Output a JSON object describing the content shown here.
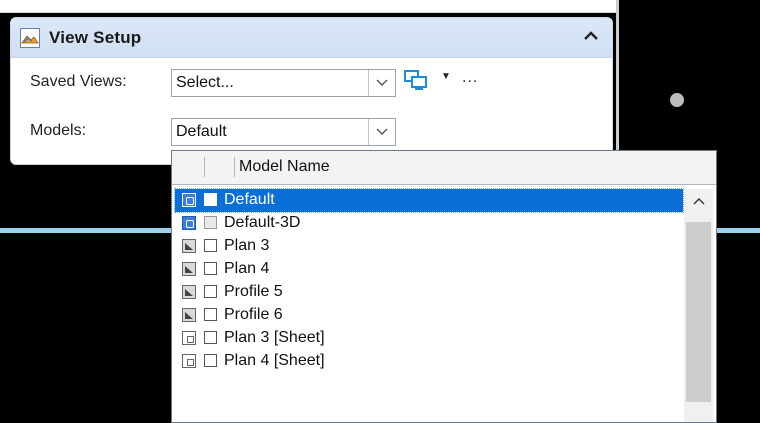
{
  "panel": {
    "title": "View Setup"
  },
  "saved_views": {
    "label": "Saved Views:",
    "value": "Select..."
  },
  "models": {
    "label": "Models:",
    "value": "Default"
  },
  "toolbar": {
    "more_label": "..."
  },
  "dropdown": {
    "column_header": "Model Name",
    "items": [
      {
        "name": "Default",
        "icon": "2d-model-icon",
        "selected": true
      },
      {
        "name": "Default-3D",
        "icon": "3d-model-icon",
        "selected": false
      },
      {
        "name": "Plan 3",
        "icon": "drawing-icon",
        "selected": false
      },
      {
        "name": "Plan 4",
        "icon": "drawing-icon",
        "selected": false
      },
      {
        "name": "Profile 5",
        "icon": "drawing-icon",
        "selected": false
      },
      {
        "name": "Profile 6",
        "icon": "drawing-icon",
        "selected": false
      },
      {
        "name": "Plan 3 [Sheet]",
        "icon": "sheet-icon",
        "selected": false
      },
      {
        "name": "Plan 4 [Sheet]",
        "icon": "sheet-icon",
        "selected": false
      }
    ]
  },
  "colors": {
    "selection": "#0a6fd6",
    "header_bg": "#dbe8f7",
    "viewport_bg": "#000000",
    "view_border": "#9fd0ea"
  }
}
